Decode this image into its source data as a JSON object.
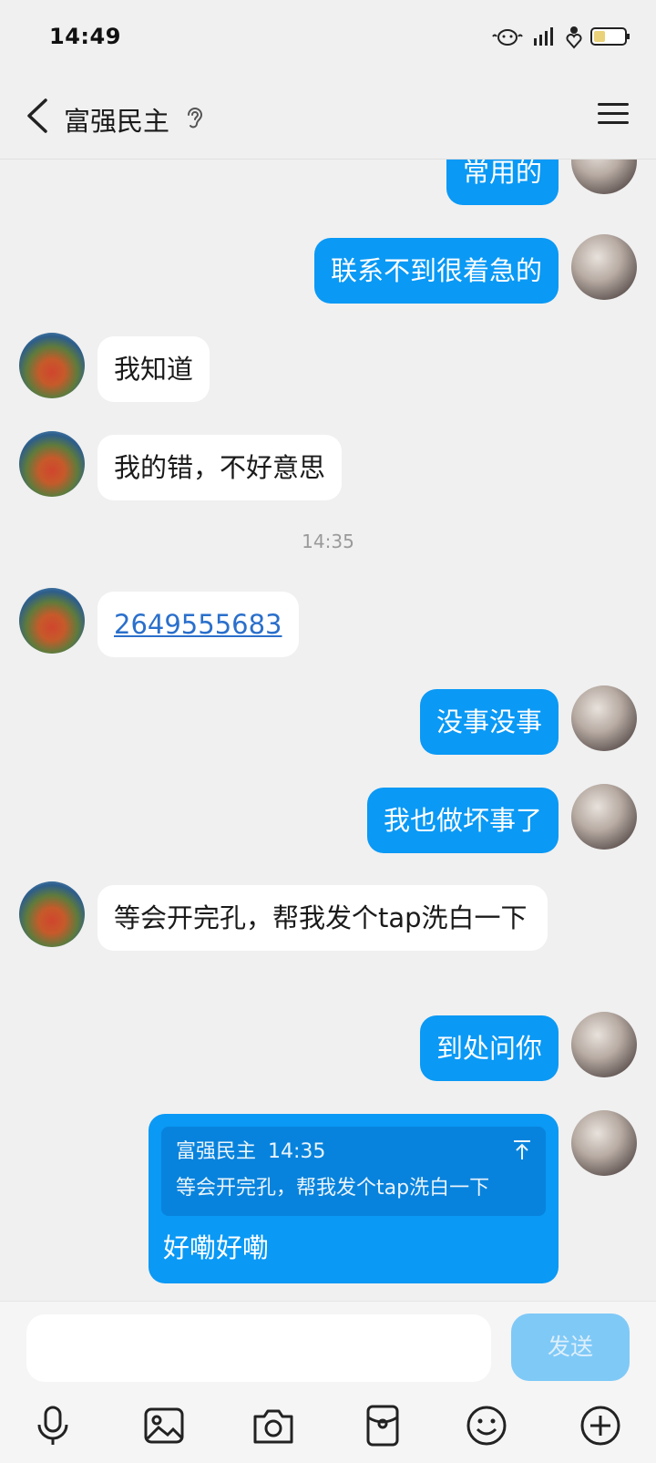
{
  "status_bar": {
    "time": "14:49"
  },
  "header": {
    "title": "富强民主"
  },
  "messages": {
    "m1": "常用的",
    "m2": "联系不到很着急的",
    "m3": "我知道",
    "m4": "我的错，不好意思",
    "time1": "14:35",
    "m5": "2649555683",
    "m6": "没事没事",
    "m7": "我也做坏事了",
    "m8": "等会开完孔，帮我发个tap洗白一下",
    "m9": "到处问你",
    "m10": {
      "quote_sender": "富强民主",
      "quote_time": "14:35",
      "quote_text": "等会开完孔，帮我发个tap洗白一下",
      "text": "好嘞好嘞"
    }
  },
  "composer": {
    "input_value": "",
    "send_label": "发送"
  },
  "toolbar_icons": [
    "microphone-icon",
    "image-icon",
    "camera-icon",
    "red-packet-icon",
    "emoji-icon",
    "plus-icon"
  ],
  "colors": {
    "self_bubble": "#0a99f5",
    "other_bubble": "#ffffff",
    "link": "#2a6fcb",
    "send_disabled": "#7fc9f7",
    "background": "#f0f0f0"
  }
}
